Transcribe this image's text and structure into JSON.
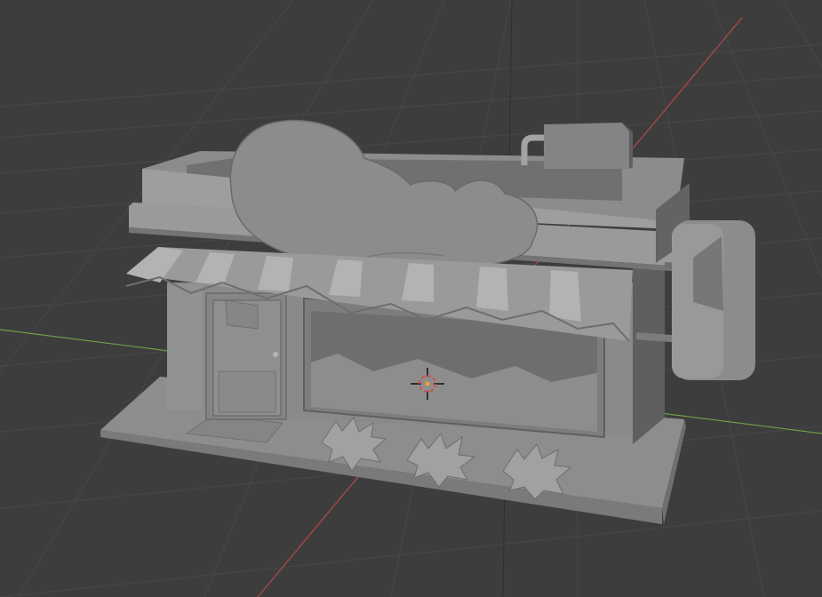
{
  "app": "3D viewport",
  "viewport": {
    "background_color": "#3d3d3d",
    "grid_line_color": "#4a4a4a",
    "x_axis_color": "#c24a4a",
    "y_axis_color": "#6fa64a",
    "z_axis_color": "#4d4d4d",
    "model_color": "#8f8f8f"
  },
  "scene": {
    "objects": [
      "ground-slab",
      "shop-building",
      "awning",
      "door",
      "display-window",
      "cloud-sign",
      "rooftop-ac-unit",
      "hanging-sign",
      "shrubs"
    ]
  },
  "cursor_3d": {
    "icon": "crosshair-target-icon",
    "ring_color": "#d94b4b",
    "center_color": "#f2a033"
  }
}
